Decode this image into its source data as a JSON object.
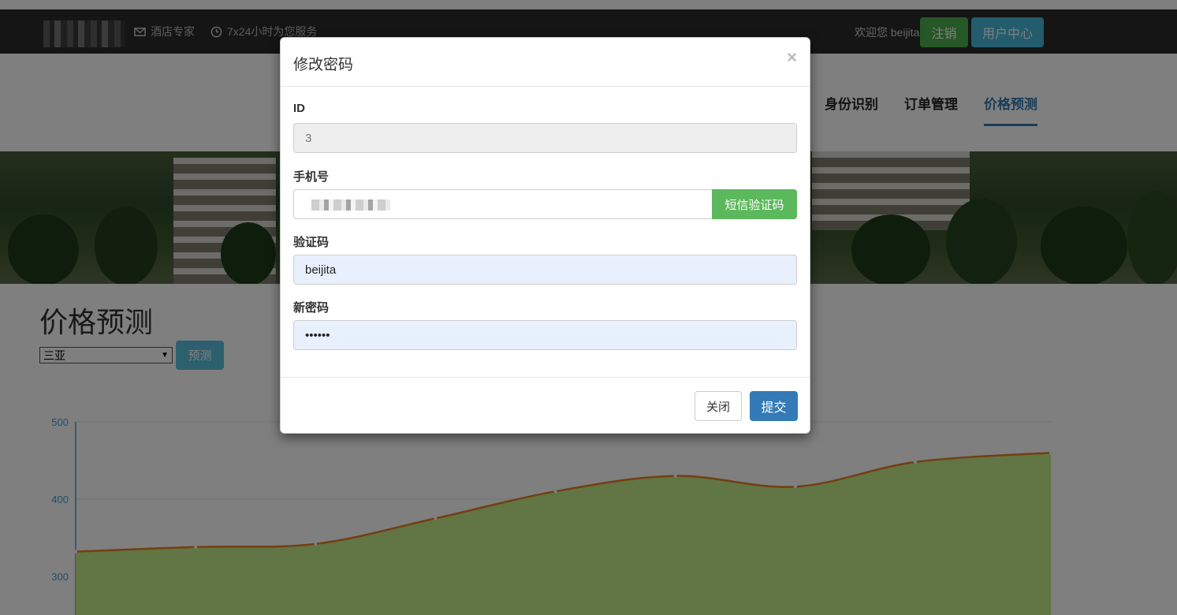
{
  "topbar": {
    "info_items": [
      {
        "icon": "mail-icon",
        "text": "酒店专家"
      },
      {
        "icon": "clock-icon",
        "text": "7x24小时为您服务"
      }
    ],
    "welcome": "欢迎您 beijita",
    "logout_label": "注销",
    "user_center_label": "用户中心"
  },
  "nav": {
    "items": [
      {
        "label": "身份识别"
      },
      {
        "label": "订单管理"
      },
      {
        "label": "价格预测",
        "active": true
      }
    ]
  },
  "main": {
    "title": "价格预测",
    "city_select": {
      "selected": "三亚"
    },
    "predict_label": "预测"
  },
  "chart_data": {
    "type": "area",
    "x": [
      0,
      1,
      2,
      3,
      4,
      5,
      6,
      7,
      8
    ],
    "series": [
      {
        "values": [
          332,
          338,
          342,
          375,
          410,
          430,
          416,
          448,
          460
        ]
      }
    ],
    "y_ticks": [
      "500",
      "400",
      "300"
    ],
    "ylim": [
      250,
      500
    ],
    "grid": true,
    "colors": {
      "line": "#e67e22",
      "area": "#c4ea88",
      "axis": "#3ca0e0"
    }
  },
  "modal": {
    "title": "修改密码",
    "close_glyph": "×",
    "fields": {
      "id": {
        "label": "ID",
        "value": "3"
      },
      "phone": {
        "label": "手机号",
        "sms_button": "短信验证码"
      },
      "code": {
        "label": "验证码",
        "value": "beijita"
      },
      "password": {
        "label": "新密码",
        "value": "••••••"
      }
    },
    "close_label": "关闭",
    "submit_label": "提交"
  }
}
